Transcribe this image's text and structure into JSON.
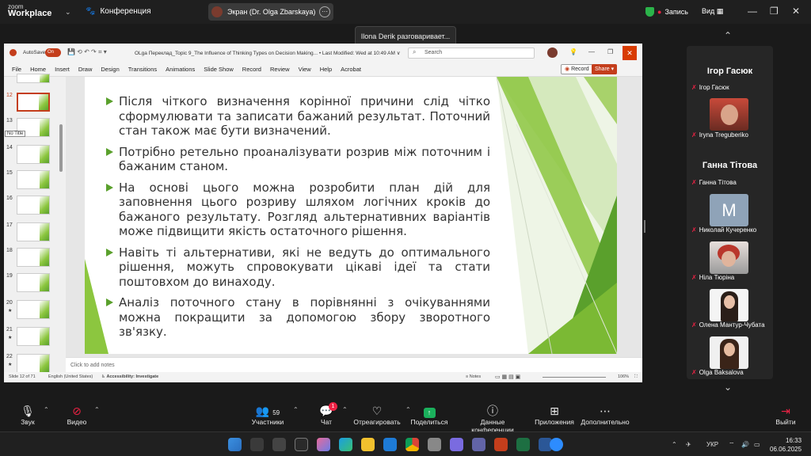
{
  "app": {
    "logo_top": "zoom",
    "logo_bottom": "Workplace",
    "conference": "Конференция",
    "share_label": "Экран (Dr. Olga Zbarskaya)",
    "recording": "Запись",
    "view": "Вид",
    "speaking_toast": "Ilona Derik разговаривает..."
  },
  "ppt": {
    "autosave": "AutoSave",
    "toggle": "On",
    "doc_title": "OLga Переклад_Topic 9_The Influence of Thinking Types on Decision Making...  •  Last Modified: Wed at 10:49 AM ∨",
    "search_placeholder": "Search",
    "menu": [
      "File",
      "Home",
      "Insert",
      "Draw",
      "Design",
      "Transitions",
      "Animations",
      "Slide Show",
      "Record",
      "Review",
      "View",
      "Help",
      "Acrobat"
    ],
    "record_btn": "Record",
    "share_btn": "Share",
    "thumb_numbers": [
      "12",
      "13",
      "14",
      "15",
      "16",
      "17",
      "18",
      "19",
      "20",
      "21",
      "22"
    ],
    "thumb_tooltip": "No Title",
    "notes_placeholder": "Click to add notes",
    "status_slide": "Slide 12 of 71",
    "status_lang": "English (United States)",
    "status_access": "Accessibility: Investigate",
    "status_notes": "Notes",
    "status_zoom": "106%"
  },
  "slide": {
    "bullets": [
      "Після чіткого визначення корінної причини слід чітко сформулювати та записати бажаний результат. Поточний стан також має бути визначений.",
      "Потрібно ретельно проаналізувати розрив між поточним і бажаним станом.",
      "На основі цього можна розробити план дій для заповнення цього розриву шляхом логічних кроків до бажаного результату. Розгляд альтернативних варіантів може підвищити якість остаточного рішення.",
      "Навіть ті альтернативи, які не ведуть до оптимального рішення, можуть спровокувати цікаві ідеї та стати поштовхом до винаходу.",
      "Аналіз поточного стану в порівнянні з очікуваннями можна покращити за допомогою збору зворотного зв'язку."
    ]
  },
  "participants": {
    "name1": "Ігор Гасюк",
    "label1": "Ігор Гасюк",
    "label2": "Iryna Treguberiko",
    "name2": "Ганна Тітова",
    "label3": "Ганна Тітова",
    "avatar_letter": "M",
    "label4": "Николай Кучеренко",
    "label5": "Ніла Тюріна",
    "label6": "Олена Мантур-Чубата",
    "label7": "Olga Baksalova"
  },
  "toolbar": {
    "sound": "Звук",
    "video": "Видео",
    "participants": "Участники",
    "participants_count": "59",
    "chat": "Чат",
    "chat_badge": "1",
    "react": "Отреагировать",
    "share": "Поделиться",
    "info": "Данные конференции",
    "apps": "Приложения",
    "more": "Дополнительно",
    "exit": "Выйти"
  },
  "taskbar": {
    "lang": "УКР",
    "time": "16:33",
    "date": "06.06.2025"
  },
  "colors": {
    "accent_green": "#5aa02c",
    "ppt_red": "#c43e1c",
    "zoom_green": "#1bb05c"
  }
}
